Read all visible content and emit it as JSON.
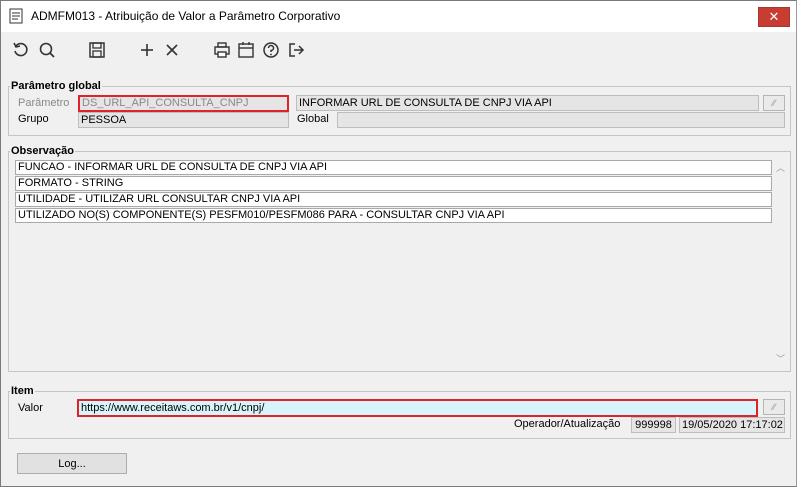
{
  "window": {
    "title": "ADMFM013 - Atribuição de Valor a Parâmetro Corporativo",
    "close_glyph": "✕",
    "minimize_glyph": "─",
    "restore_glyph": "☐"
  },
  "toolbar": {
    "icons": [
      "refresh-icon",
      "search-icon",
      "save-icon",
      "add-icon",
      "delete-icon",
      "print-icon",
      "calendar-icon",
      "help-icon",
      "exit-icon"
    ]
  },
  "parametro_global": {
    "section_title": "Parâmetro global",
    "parametro_label": "Parâmetro",
    "parametro_value": "DS_URL_API_CONSULTA_CNPJ",
    "descricao_value": "INFORMAR URL DE CONSULTA DE CNPJ VIA API",
    "grupo_label": "Grupo",
    "grupo_value": "PESSOA",
    "global_label": "Global",
    "global_value": ""
  },
  "observacao": {
    "section_title": "Observação",
    "lines": [
      "FUNCAO -  INFORMAR URL DE CONSULTA DE CNPJ VIA API",
      "FORMATO - STRING",
      "UTILIDADE - UTILIZAR URL CONSULTAR CNPJ VIA  API",
      "UTILIZADO NO(S) COMPONENTE(S) PESFM010/PESFM086  PARA  - CONSULTAR CNPJ VIA  API"
    ]
  },
  "item": {
    "section_title": "Item",
    "valor_label": "Valor",
    "valor_value": "https://www.receitaws.com.br/v1/cnpj/",
    "operador_label": "Operador/Atualização",
    "operador_value": "999998",
    "data_value": "19/05/2020 17:17:02"
  },
  "footer": {
    "log_button": "Log..."
  },
  "colors": {
    "highlight": "#e0232a",
    "readonly_bg": "#e5e5e5",
    "valor_bg": "#d8f4fb",
    "close_btn": "#c83d32"
  }
}
